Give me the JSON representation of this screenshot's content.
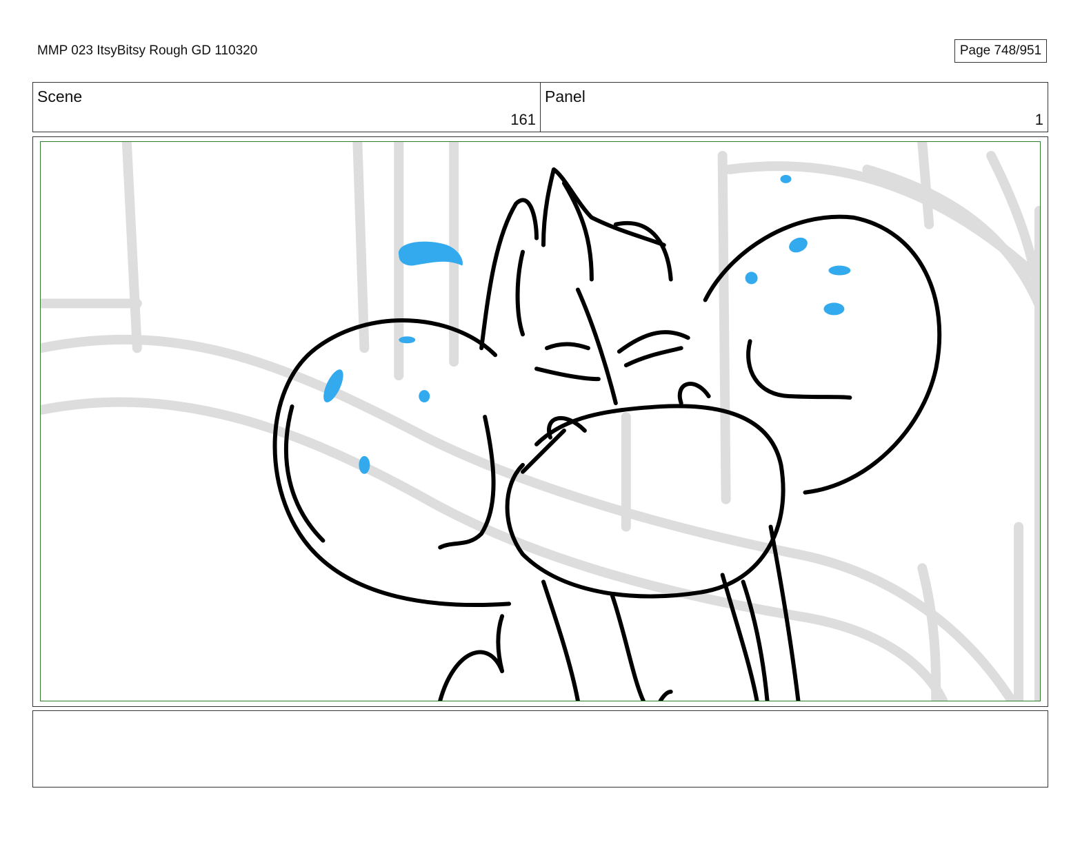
{
  "header": {
    "doc_title": "MMP 023 ItsyBitsy Rough GD 110320",
    "page_label": "Page 748/951"
  },
  "scene": {
    "label": "Scene",
    "value": "161"
  },
  "panel": {
    "label": "Panel",
    "value": "1"
  },
  "colors": {
    "frame_border": "#2f7a2f",
    "ink": "#000000",
    "sweat": "#33aaee",
    "background_sketch": "#d6d6d6"
  },
  "notes": {
    "text": ""
  }
}
